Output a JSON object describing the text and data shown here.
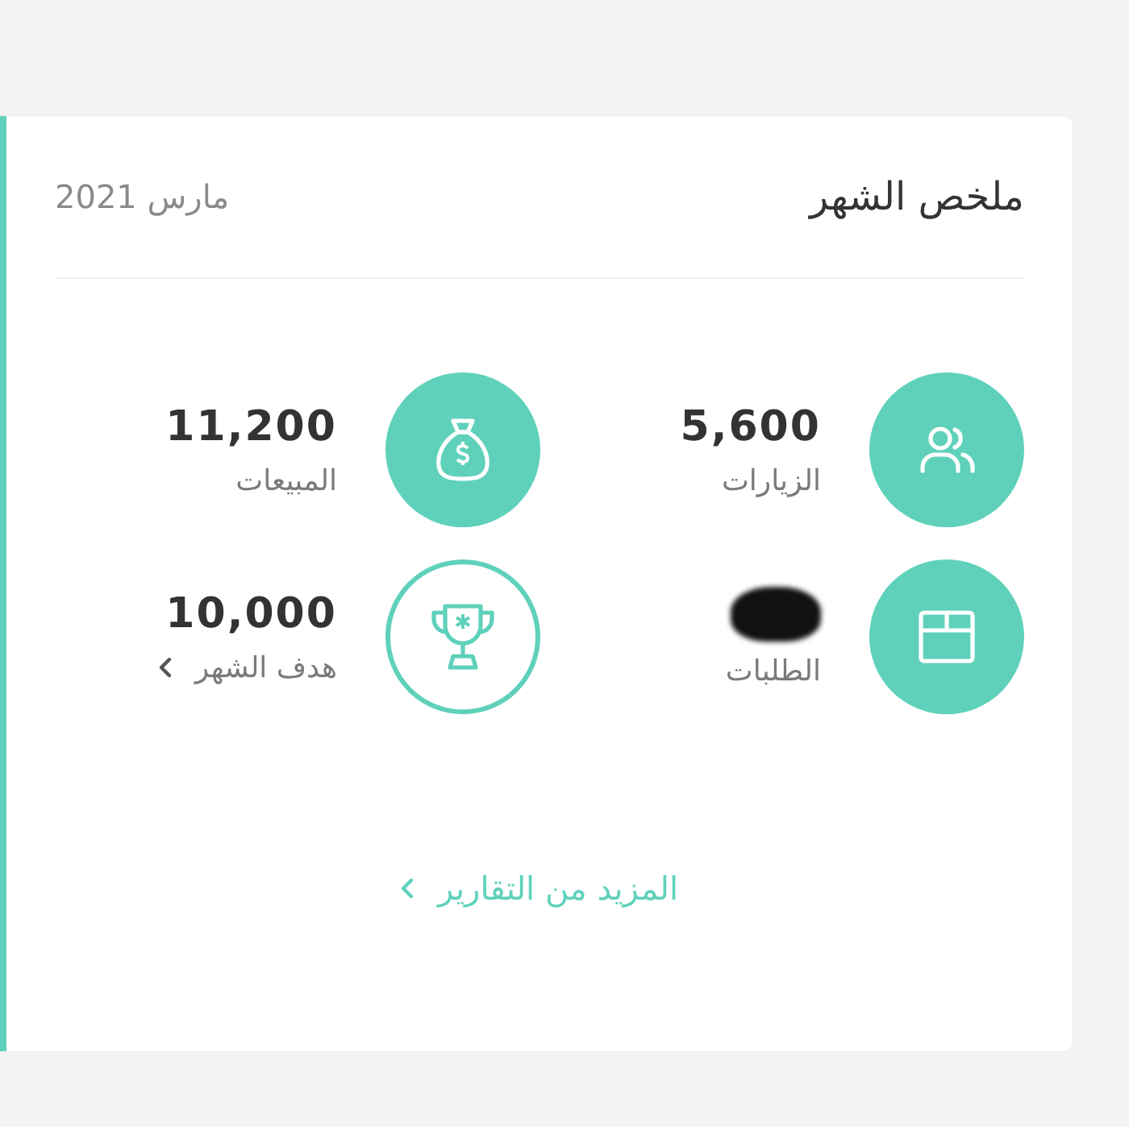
{
  "card": {
    "title": "ملخص الشهر",
    "date": "مارس 2021"
  },
  "stats": [
    {
      "kind": "filled",
      "value": "5,600",
      "label": "الزيارات",
      "link": false
    },
    {
      "kind": "filled",
      "redacted": true,
      "label": "الطلبات",
      "link": false
    },
    {
      "kind": "filled",
      "value": "11,200",
      "label": "المبيعات",
      "link": false
    },
    {
      "kind": "outline",
      "value": "10,000",
      "label": "هدف الشهر",
      "link": true
    }
  ],
  "more_link": "المزيد من التقارير"
}
